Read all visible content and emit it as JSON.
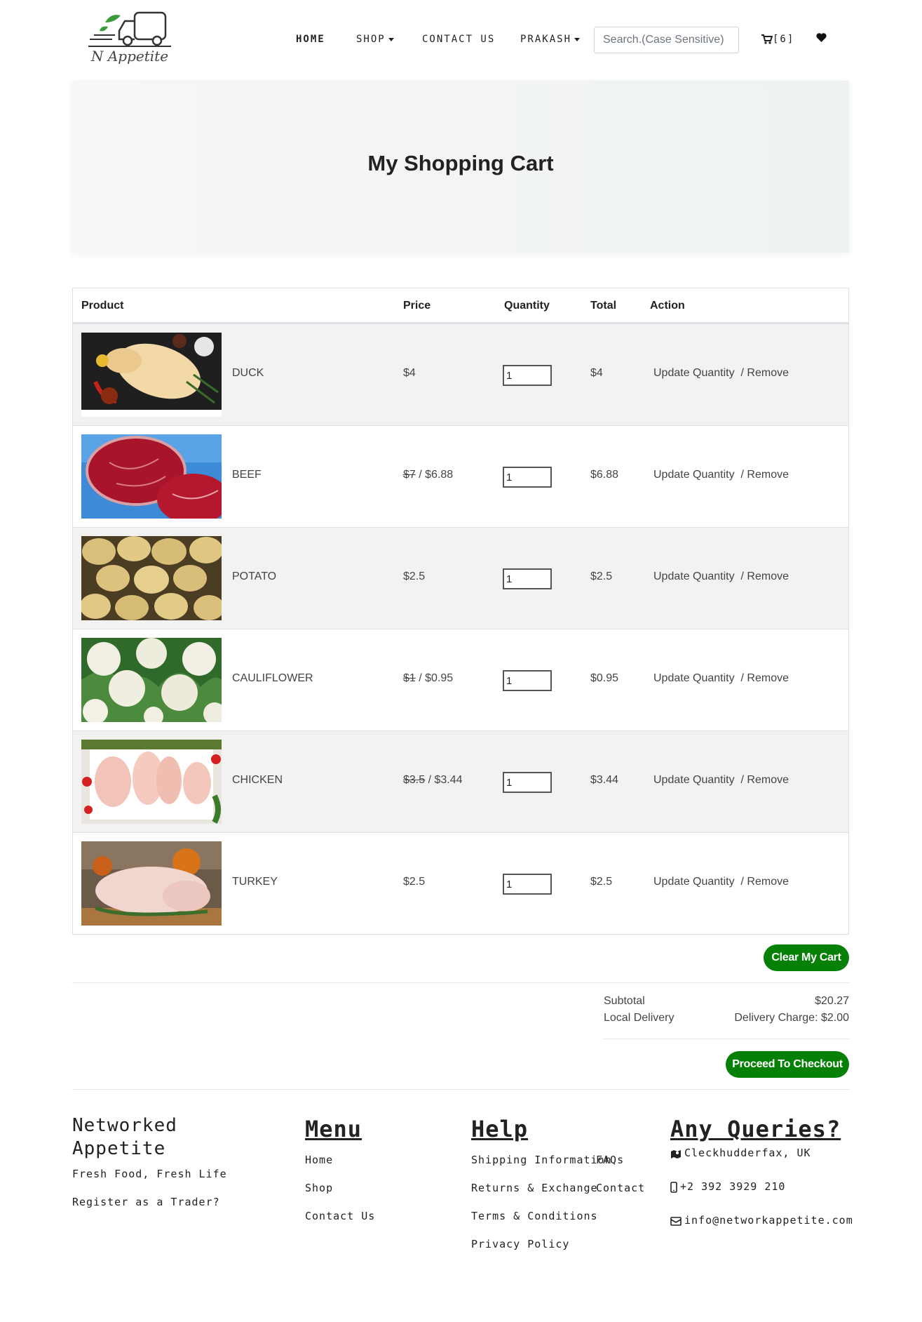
{
  "header": {
    "logo_text": "N Appetite",
    "nav": {
      "home": "HOME",
      "shop": "SHOP",
      "contact": "CONTACT US",
      "user": "PRAKASH"
    },
    "search_placeholder": "Search.(Case Sensitive)",
    "cart_label": "[6]",
    "icons": {
      "cart": "cart-icon",
      "wishlist": "heart-icon"
    }
  },
  "hero": {
    "title": "My Shopping Cart"
  },
  "cart": {
    "columns": [
      "Product",
      "Price",
      "Quantity",
      "Total",
      "Action"
    ],
    "rows": [
      {
        "name": "DUCK",
        "old_price": "",
        "price": "$4",
        "qty": "1",
        "total": "$4",
        "update": "Update Quantity",
        "remove": "/ Remove"
      },
      {
        "name": "BEEF",
        "old_price": "$7",
        "price": "/ $6.88",
        "qty": "1",
        "total": "$6.88",
        "update": "Update Quantity",
        "remove": "/ Remove"
      },
      {
        "name": "POTATO",
        "old_price": "",
        "price": "$2.5",
        "qty": "1",
        "total": "$2.5",
        "update": "Update Quantity",
        "remove": "/ Remove"
      },
      {
        "name": "CAULIFLOWER",
        "old_price": "$1",
        "price": "/ $0.95",
        "qty": "1",
        "total": "$0.95",
        "update": "Update Quantity",
        "remove": "/ Remove"
      },
      {
        "name": "CHICKEN",
        "old_price": "$3.5",
        "price": "/ $3.44",
        "qty": "1",
        "total": "$3.44",
        "update": "Update Quantity",
        "remove": "/ Remove"
      },
      {
        "name": "TURKEY",
        "old_price": "",
        "price": "$2.5",
        "qty": "1",
        "total": "$2.5",
        "update": "Update Quantity",
        "remove": "/ Remove"
      }
    ],
    "clear_label": "Clear My Cart"
  },
  "totals": {
    "subtotal_label": "Subtotal",
    "subtotal_value": "$20.27",
    "delivery_label": "Local Delivery",
    "delivery_value": "Delivery Charge: $2.00",
    "checkout_label": "Proceed To Checkout"
  },
  "footer": {
    "brand_line1": "Networked",
    "brand_line2": "Appetite",
    "tagline": "Fresh Food, Fresh Life",
    "register": "Register as a Trader?",
    "menu_title": "Menu",
    "menu_links": [
      "Home",
      "Shop",
      "Contact Us"
    ],
    "help_title": "Help",
    "help_links": [
      "Shipping Information",
      "Returns & Exchange",
      "Terms & Conditions",
      "Privacy Policy"
    ],
    "help_links_2": [
      "FAQs",
      "Contact"
    ],
    "queries_title": "Any Queries?",
    "address": "Cleckhudderfax, UK",
    "phone": "+2 392 3929 210",
    "email": "info@networkappetite.com"
  },
  "colors": {
    "accent_green": "#078007",
    "text": "#333333",
    "border": "#dee2e6",
    "stripe": "#f2f2f2"
  }
}
